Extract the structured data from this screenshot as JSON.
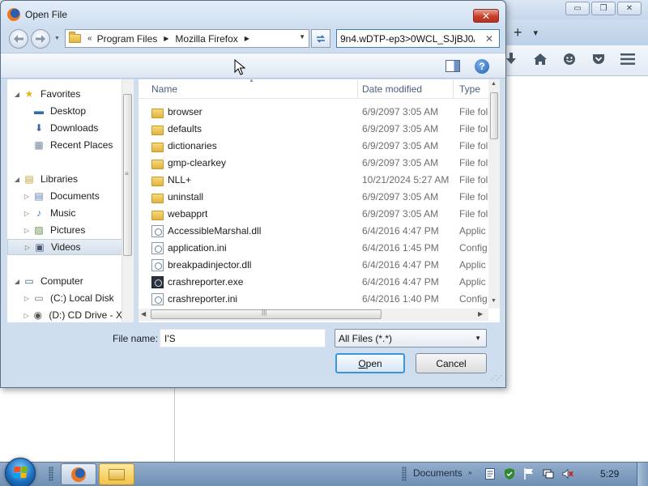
{
  "background_window": {
    "tab_new_symbol": "+",
    "tab_list_symbol": "▾",
    "window_controls": [
      "▭",
      "❐",
      "✕"
    ]
  },
  "dialog": {
    "title": "Open File",
    "close_symbol": "✕",
    "address": {
      "chevron": "«",
      "segments": [
        "Program Files",
        "Mozilla Firefox"
      ]
    },
    "search_value": "9n4.wDTP-ep3>0WCL_SJjBJ0A",
    "search_clear": "✕",
    "help_symbol": "?",
    "nav_pane": {
      "items": [
        {
          "label": "Favorites",
          "icon": "star-icon",
          "arrow": "◢",
          "indent": 0,
          "selected": false
        },
        {
          "label": "Desktop",
          "icon": "desktop-icon",
          "arrow": "",
          "indent": 1,
          "selected": false
        },
        {
          "label": "Downloads",
          "icon": "downloads-icon",
          "arrow": "",
          "indent": 1,
          "selected": false
        },
        {
          "label": "Recent Places",
          "icon": "recent-places-icon",
          "arrow": "",
          "indent": 1,
          "selected": false
        },
        {
          "label": "Libraries",
          "icon": "libraries-icon",
          "arrow": "◢",
          "indent": 0,
          "selected": false
        },
        {
          "label": "Documents",
          "icon": "documents-icon",
          "arrow": "▷",
          "indent": 1,
          "selected": false
        },
        {
          "label": "Music",
          "icon": "music-icon",
          "arrow": "▷",
          "indent": 1,
          "selected": false
        },
        {
          "label": "Pictures",
          "icon": "pictures-icon",
          "arrow": "▷",
          "indent": 1,
          "selected": false
        },
        {
          "label": "Videos",
          "icon": "videos-icon",
          "arrow": "▷",
          "indent": 1,
          "selected": true
        },
        {
          "label": "Computer",
          "icon": "computer-icon",
          "arrow": "◢",
          "indent": 0,
          "selected": false
        },
        {
          "label": "(C:) Local Disk",
          "icon": "local-disk-icon",
          "arrow": "▷",
          "indent": 1,
          "selected": false
        },
        {
          "label": "(D:) CD Drive - X",
          "icon": "cd-drive-icon",
          "arrow": "▷",
          "indent": 1,
          "selected": false
        }
      ]
    },
    "file_list": {
      "columns": [
        "Name",
        "Date modified",
        "Type"
      ],
      "rows": [
        {
          "name": "browser",
          "date": "6/9/2097 3:05 AM",
          "type": "File fol",
          "kind": "folder"
        },
        {
          "name": "defaults",
          "date": "6/9/2097 3:05 AM",
          "type": "File fol",
          "kind": "folder"
        },
        {
          "name": "dictionaries",
          "date": "6/9/2097 3:05 AM",
          "type": "File fol",
          "kind": "folder"
        },
        {
          "name": "gmp-clearkey",
          "date": "6/9/2097 3:05 AM",
          "type": "File fol",
          "kind": "folder"
        },
        {
          "name": "NLL+",
          "date": "10/21/2024 5:27 AM",
          "type": "File fol",
          "kind": "folder"
        },
        {
          "name": "uninstall",
          "date": "6/9/2097 3:05 AM",
          "type": "File fol",
          "kind": "folder"
        },
        {
          "name": "webapprt",
          "date": "6/9/2097 3:05 AM",
          "type": "File fol",
          "kind": "folder"
        },
        {
          "name": "AccessibleMarshal.dll",
          "date": "6/4/2016 4:47 PM",
          "type": "Applic",
          "kind": "file"
        },
        {
          "name": "application.ini",
          "date": "6/4/2016 1:45 PM",
          "type": "Config",
          "kind": "file"
        },
        {
          "name": "breakpadinjector.dll",
          "date": "6/4/2016 4:47 PM",
          "type": "Applic",
          "kind": "file"
        },
        {
          "name": "crashreporter.exe",
          "date": "6/4/2016 4:47 PM",
          "type": "Applic",
          "kind": "exe"
        },
        {
          "name": "crashreporter.ini",
          "date": "6/4/2016 1:40 PM",
          "type": "Config",
          "kind": "file"
        }
      ]
    },
    "file_name_label": "File name:",
    "file_name_value": "I'S",
    "file_type_filter": "All Files (*.*)",
    "open_label": "Open",
    "cancel_label": "Cancel"
  },
  "taskbar": {
    "toolbar_label": "Documents",
    "clock": "5:29"
  },
  "colors": {
    "dialog_frame": "#cfdeee",
    "close_button": "#c7402c",
    "accent": "#3d95d6",
    "taskbar": "#7f9ec0"
  }
}
